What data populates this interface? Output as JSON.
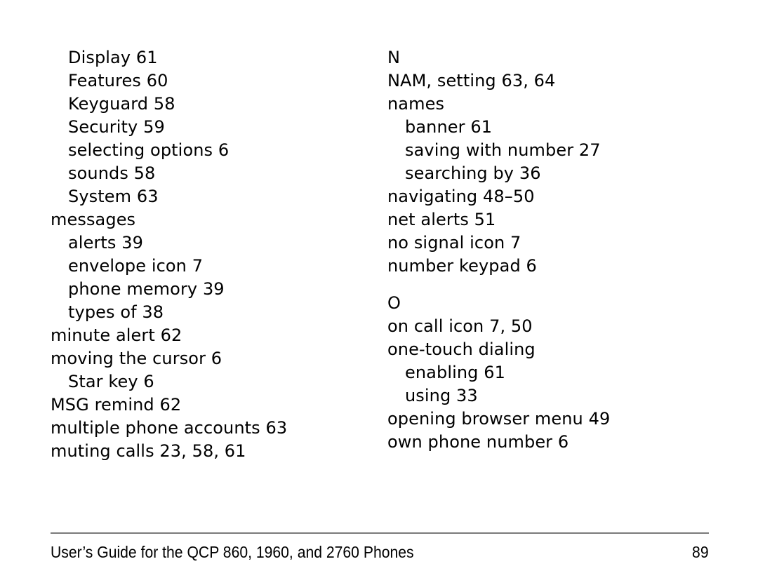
{
  "page": {
    "background_color": "#ffffff",
    "text_color": "#000000",
    "rule_color": "#7a7a7a"
  },
  "index": {
    "left_column": {
      "entries": [
        {
          "text": "Display 61",
          "level": 2
        },
        {
          "text": "Features 60",
          "level": 2
        },
        {
          "text": "Keyguard 58",
          "level": 2
        },
        {
          "text": "Security 59",
          "level": 2
        },
        {
          "text": "selecting options 6",
          "level": 2
        },
        {
          "text": "sounds 58",
          "level": 2
        },
        {
          "text": "System 63",
          "level": 2
        },
        {
          "text": "messages",
          "level": 1
        },
        {
          "text": "alerts 39",
          "level": 2
        },
        {
          "text": "envelope icon 7",
          "level": 2
        },
        {
          "text": "phone memory 39",
          "level": 2
        },
        {
          "text": "types of 38",
          "level": 2
        },
        {
          "text": "minute alert 62",
          "level": 1
        },
        {
          "text": "moving the cursor 6",
          "level": 1
        },
        {
          "text": "Star key 6",
          "level": 2
        },
        {
          "text": "MSG remind 62",
          "level": 1
        },
        {
          "text": "multiple phone accounts 63",
          "level": 1
        },
        {
          "text": "muting calls 23, 58, 61",
          "level": 1
        }
      ]
    },
    "right_column": {
      "sections": [
        {
          "heading": "N",
          "spaced": false,
          "entries": [
            {
              "text": "NAM, setting 63, 64",
              "level": 1
            },
            {
              "text": "names",
              "level": 1
            },
            {
              "text": "banner 61",
              "level": 2
            },
            {
              "text": "saving with number 27",
              "level": 2
            },
            {
              "text": "searching by 36",
              "level": 2
            },
            {
              "text": "navigating 48–50",
              "level": 1
            },
            {
              "text": "net alerts 51",
              "level": 1
            },
            {
              "text": "no signal icon 7",
              "level": 1
            },
            {
              "text": "number keypad 6",
              "level": 1
            }
          ]
        },
        {
          "heading": "O",
          "spaced": true,
          "entries": [
            {
              "text": "on call icon 7, 50",
              "level": 1
            },
            {
              "text": "one-touch dialing",
              "level": 1
            },
            {
              "text": "enabling 61",
              "level": 2
            },
            {
              "text": "using 33",
              "level": 2
            },
            {
              "text": "opening browser menu 49",
              "level": 1
            },
            {
              "text": "own phone number 6",
              "level": 1
            }
          ]
        }
      ]
    }
  },
  "footer": {
    "title": "User’s Guide for the QCP 860, 1960, and 2760 Phones",
    "page_number": "89"
  }
}
